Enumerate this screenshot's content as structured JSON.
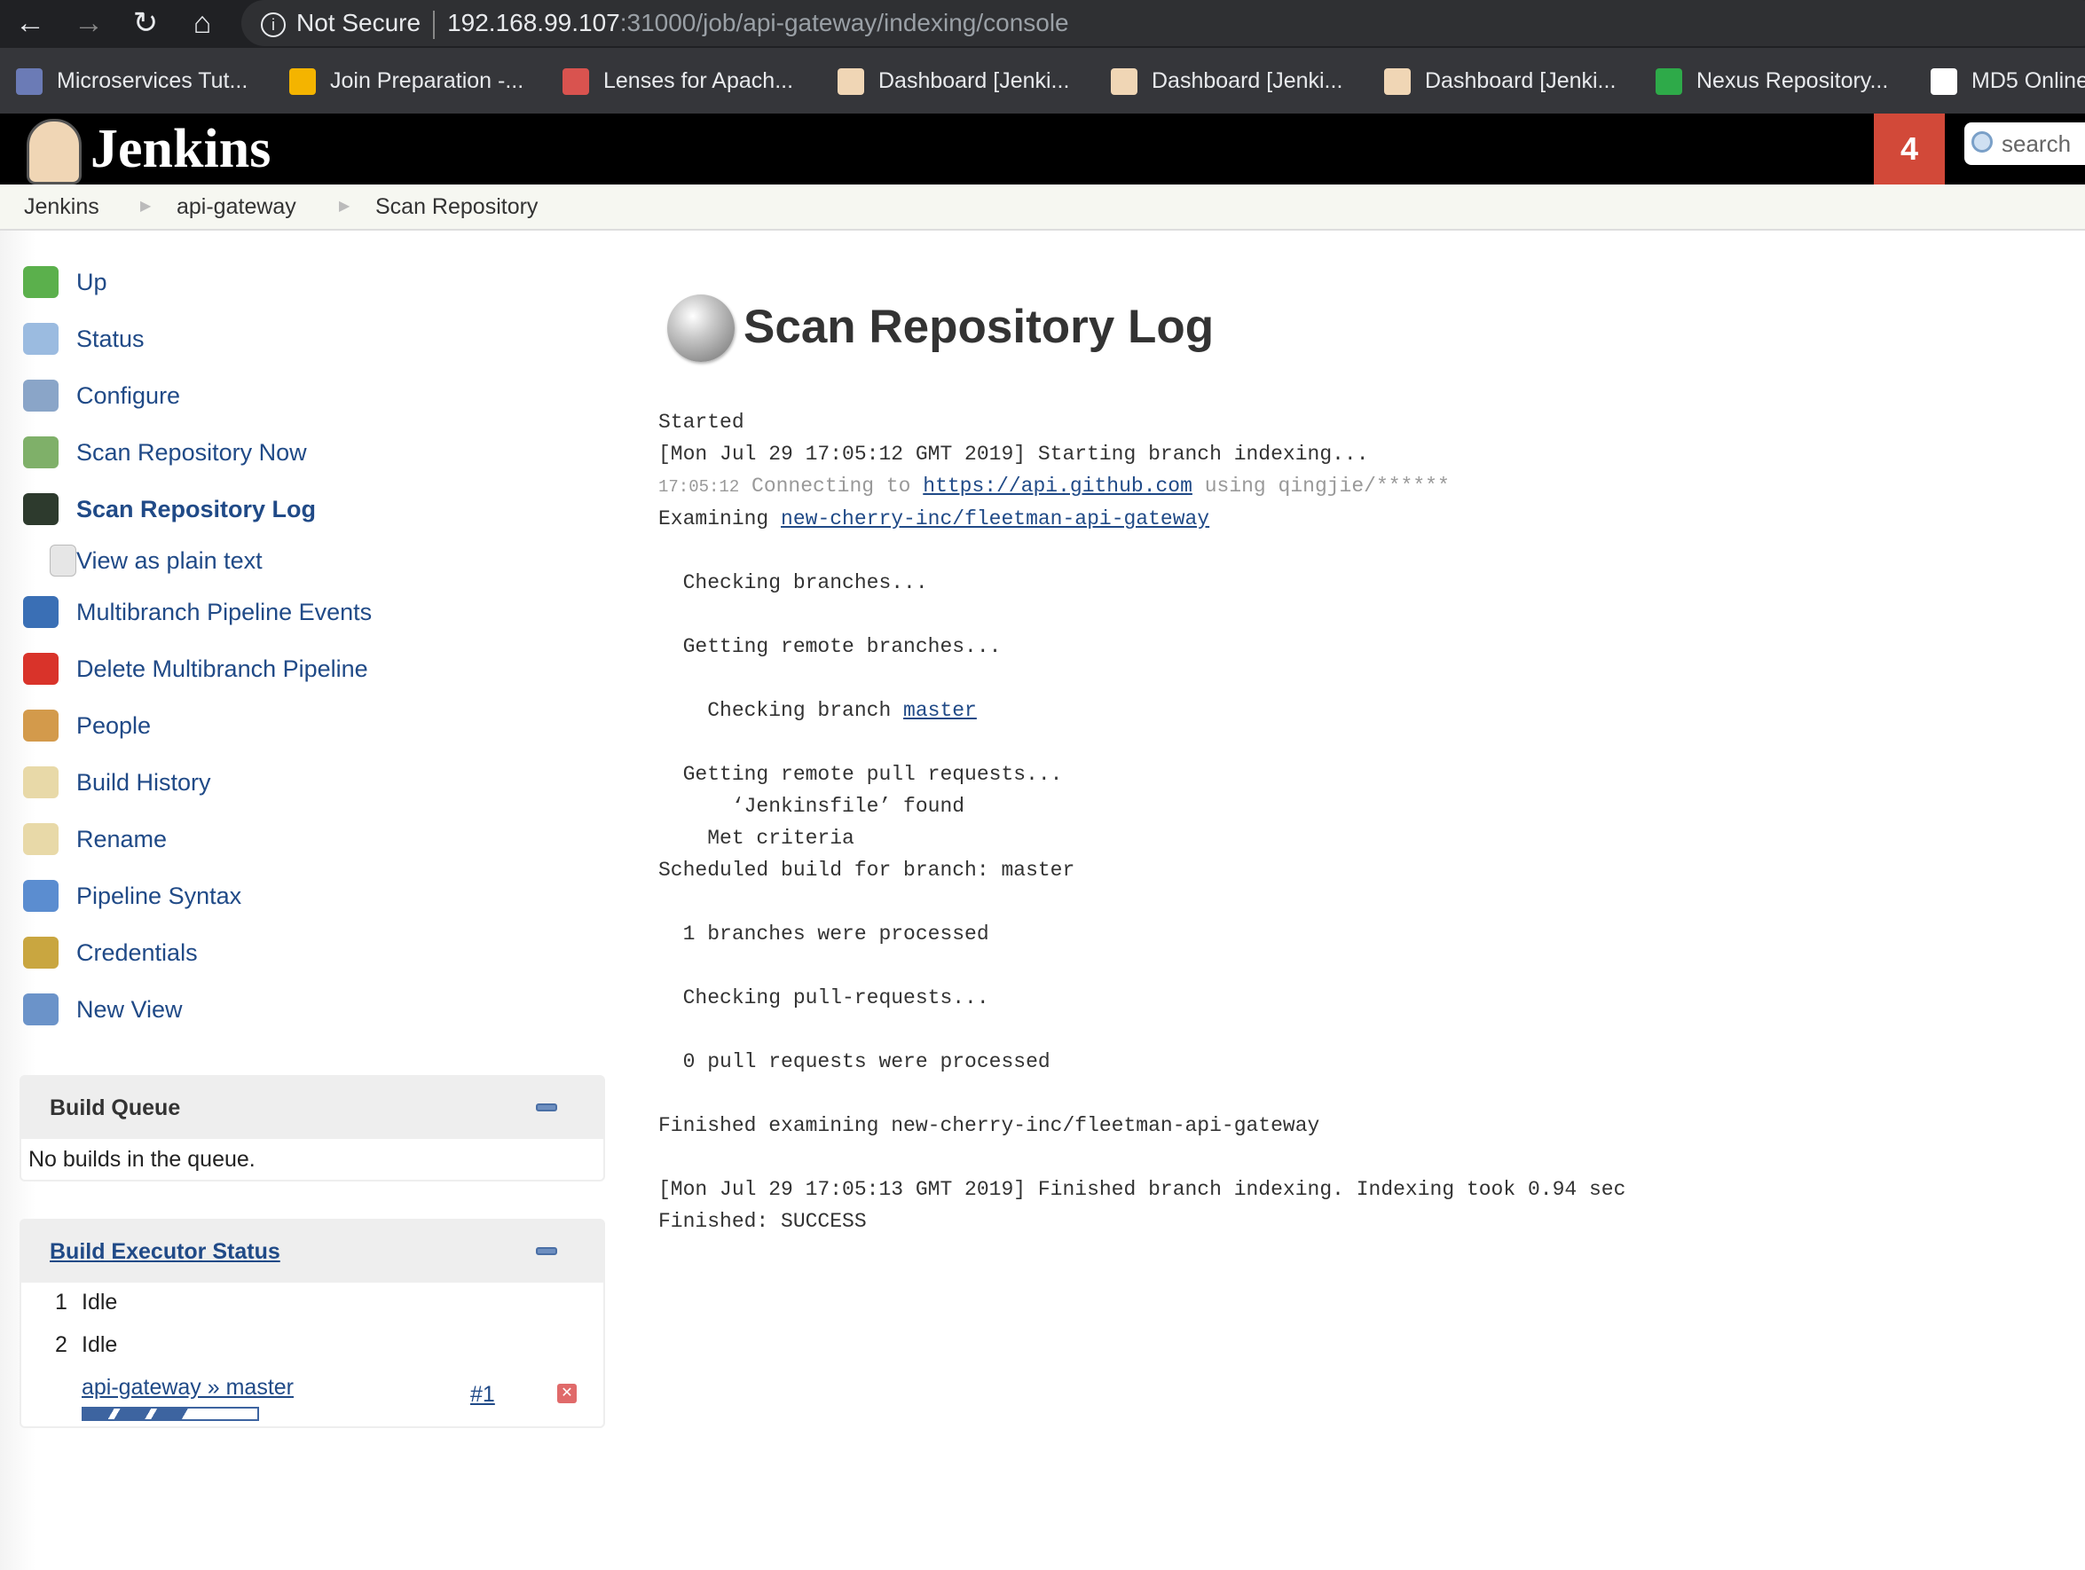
{
  "browser": {
    "security": "Not Secure",
    "url_host": "192.168.99.107",
    "url_rest": ":31000/job/api-gateway/indexing/console",
    "bookmarks": [
      {
        "label": "Microservices Tut...",
        "icon": "hexagon-icon",
        "color": "#6b7bb6"
      },
      {
        "label": "Join Preparation -...",
        "icon": "google-drive-icon",
        "color": "#f4b400"
      },
      {
        "label": "Lenses for Apach...",
        "icon": "lenses-icon",
        "color": "#d9534f"
      },
      {
        "label": "Dashboard [Jenki...",
        "icon": "jenkins-icon",
        "color": "#f0d6b5"
      },
      {
        "label": "Dashboard [Jenki...",
        "icon": "jenkins-icon",
        "color": "#f0d6b5"
      },
      {
        "label": "Dashboard [Jenki...",
        "icon": "jenkins-icon",
        "color": "#f0d6b5"
      },
      {
        "label": "Nexus Repository...",
        "icon": "nexus-icon",
        "color": "#2eaa49"
      },
      {
        "label": "MD5 Online",
        "icon": "lock-icon",
        "color": "#ffffff"
      }
    ]
  },
  "header": {
    "logo": "Jenkins",
    "notification_count": "4",
    "search_placeholder": "search"
  },
  "breadcrumb": [
    "Jenkins",
    "api-gateway",
    "Scan Repository"
  ],
  "sidebar": {
    "items": [
      {
        "label": "Up",
        "icon": "up-arrow-icon",
        "color": "#5bb04c"
      },
      {
        "label": "Status",
        "icon": "magnifier-icon",
        "color": "#9bbbe0"
      },
      {
        "label": "Configure",
        "icon": "tools-icon",
        "color": "#8aa5c8"
      },
      {
        "label": "Scan Repository Now",
        "icon": "clock-icon",
        "color": "#7fb069"
      },
      {
        "label": "Scan Repository Log",
        "icon": "terminal-icon",
        "color": "#2d3a2d",
        "active": true
      },
      {
        "label": "View as plain text",
        "icon": "document-icon",
        "color": "#e6e6e6",
        "indent": true
      },
      {
        "label": "Multibranch Pipeline Events",
        "icon": "monitor-icon",
        "color": "#3a6fb5"
      },
      {
        "label": "Delete Multibranch Pipeline",
        "icon": "no-entry-icon",
        "color": "#d9332a"
      },
      {
        "label": "People",
        "icon": "people-icon",
        "color": "#d39a4b"
      },
      {
        "label": "Build History",
        "icon": "notepad-icon",
        "color": "#e8d9a8"
      },
      {
        "label": "Rename",
        "icon": "notepad-icon",
        "color": "#e8d9a8"
      },
      {
        "label": "Pipeline Syntax",
        "icon": "help-icon",
        "color": "#5b8dd0"
      },
      {
        "label": "Credentials",
        "icon": "keys-icon",
        "color": "#c9a640"
      },
      {
        "label": "New View",
        "icon": "folder-icon",
        "color": "#6b93c9"
      }
    ]
  },
  "build_queue": {
    "title": "Build Queue",
    "empty": "No builds in the queue."
  },
  "executors": {
    "title": "Build Executor Status",
    "rows": [
      {
        "num": "1",
        "status": "Idle"
      },
      {
        "num": "2",
        "status": "Idle"
      }
    ],
    "running": {
      "job": "api-gateway » master",
      "build": "#1",
      "progress": 0.6
    }
  },
  "main": {
    "title": "Scan Repository Log",
    "log": [
      [
        {
          "t": "Started"
        }
      ],
      [
        {
          "t": "[Mon Jul 29 17:05:12 GMT 2019] Starting branch indexing..."
        }
      ],
      [
        {
          "t": "17:05:12",
          "c": "gray small"
        },
        {
          "t": " Connecting to ",
          "c": "gray"
        },
        {
          "t": "https://api.github.com",
          "link": true
        },
        {
          "t": " using qingjie/******",
          "c": "gray"
        }
      ],
      [
        {
          "t": "Examining "
        },
        {
          "t": "new-cherry-inc/fleetman-api-gateway",
          "link": true
        }
      ],
      [
        {
          "t": ""
        }
      ],
      [
        {
          "t": "  Checking branches..."
        }
      ],
      [
        {
          "t": ""
        }
      ],
      [
        {
          "t": "  Getting remote branches..."
        }
      ],
      [
        {
          "t": ""
        }
      ],
      [
        {
          "t": "    Checking branch "
        },
        {
          "t": "master",
          "link": true
        }
      ],
      [
        {
          "t": ""
        }
      ],
      [
        {
          "t": "  Getting remote pull requests..."
        }
      ],
      [
        {
          "t": "      ‘Jenkinsfile’ found"
        }
      ],
      [
        {
          "t": "    Met criteria"
        }
      ],
      [
        {
          "t": "Scheduled build for branch: master"
        }
      ],
      [
        {
          "t": ""
        }
      ],
      [
        {
          "t": "  1 branches were processed"
        }
      ],
      [
        {
          "t": ""
        }
      ],
      [
        {
          "t": "  Checking pull-requests..."
        }
      ],
      [
        {
          "t": ""
        }
      ],
      [
        {
          "t": "  0 pull requests were processed"
        }
      ],
      [
        {
          "t": ""
        }
      ],
      [
        {
          "t": "Finished examining new-cherry-inc/fleetman-api-gateway"
        }
      ],
      [
        {
          "t": ""
        }
      ],
      [
        {
          "t": "[Mon Jul 29 17:05:13 GMT 2019] Finished branch indexing. Indexing took 0.94 sec"
        }
      ],
      [
        {
          "t": "Finished: SUCCESS"
        }
      ]
    ]
  }
}
